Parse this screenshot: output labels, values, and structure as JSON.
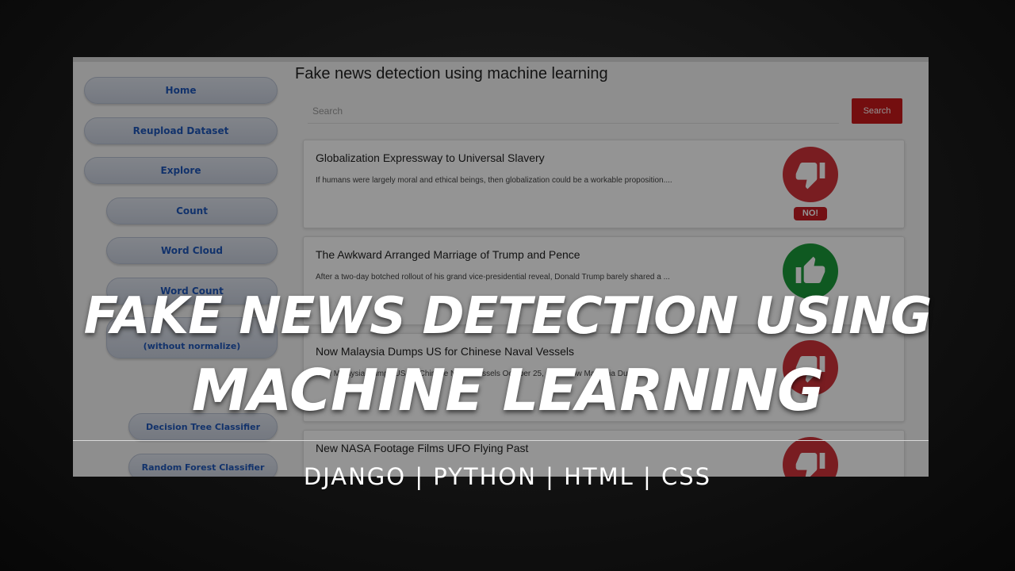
{
  "app": {
    "title": "Fake news detection using machine learning",
    "search": {
      "placeholder": "Search",
      "button_label": "Search"
    },
    "sidebar": {
      "home": "Home",
      "reupload": "Reupload Dataset",
      "explore": "Explore",
      "count": "Count",
      "word_cloud": "Word Cloud",
      "word_count": "Word Count",
      "confusion_line2": "(without normalize)",
      "decision_tree": "Decision Tree Classifier",
      "random_forest": "Random Forest Classifier"
    },
    "news": [
      {
        "title": "Globalization Expressway to Universal Slavery",
        "description": "If humans were largely moral and ethical beings, then globalization could be a workable proposition....",
        "verdict": "fake",
        "badge": "NO!"
      },
      {
        "title": "The Awkward Arranged Marriage of Trump and Pence",
        "description": "After a two-day botched rollout of his grand vice-presidential reveal, Donald Trump barely shared a ...",
        "verdict": "real"
      },
      {
        "title": "Now Malaysia Dumps US for Chinese Naval Vessels",
        "description": "Now Malaysia Dumps US for Chinese Naval Vessels October 25, 2016 Now Malaysia Dumps",
        "verdict": "fake"
      },
      {
        "title": "New NASA Footage Films UFO Flying Past",
        "description": "",
        "verdict": "fake"
      }
    ]
  },
  "overlay": {
    "headline_line1": "FAKE NEWS DETECTION USING",
    "headline_line2": "MACHINE LEARNING",
    "tagline": "DJANGO | PYTHON | HTML | CSS"
  },
  "colors": {
    "search_button": "#c8191a",
    "fake_icon": "#d0333a",
    "real_icon": "#1b9a3a",
    "sidebar_text": "#1f57b8"
  },
  "icons": {
    "fake": "thumbs-down-icon",
    "real": "thumbs-up-icon"
  }
}
